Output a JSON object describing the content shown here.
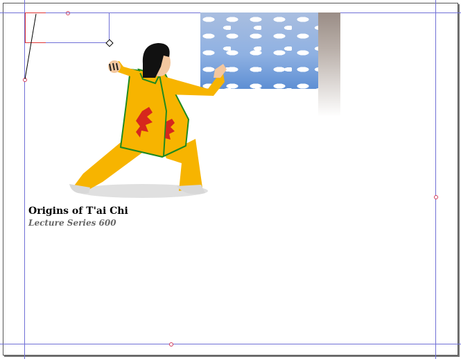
{
  "document": {
    "title": "Origins of T'ai Chi",
    "subtitle": "Lecture Series 600"
  },
  "images": {
    "sky": "sky-photo",
    "figure": "tai-chi-figure-illustration"
  },
  "colors": {
    "guide": "#6f6fd6",
    "anchor": "#d23b5a",
    "suit": "#f7b400",
    "dragon": "#d6271d",
    "trim": "#1f8a1f"
  }
}
